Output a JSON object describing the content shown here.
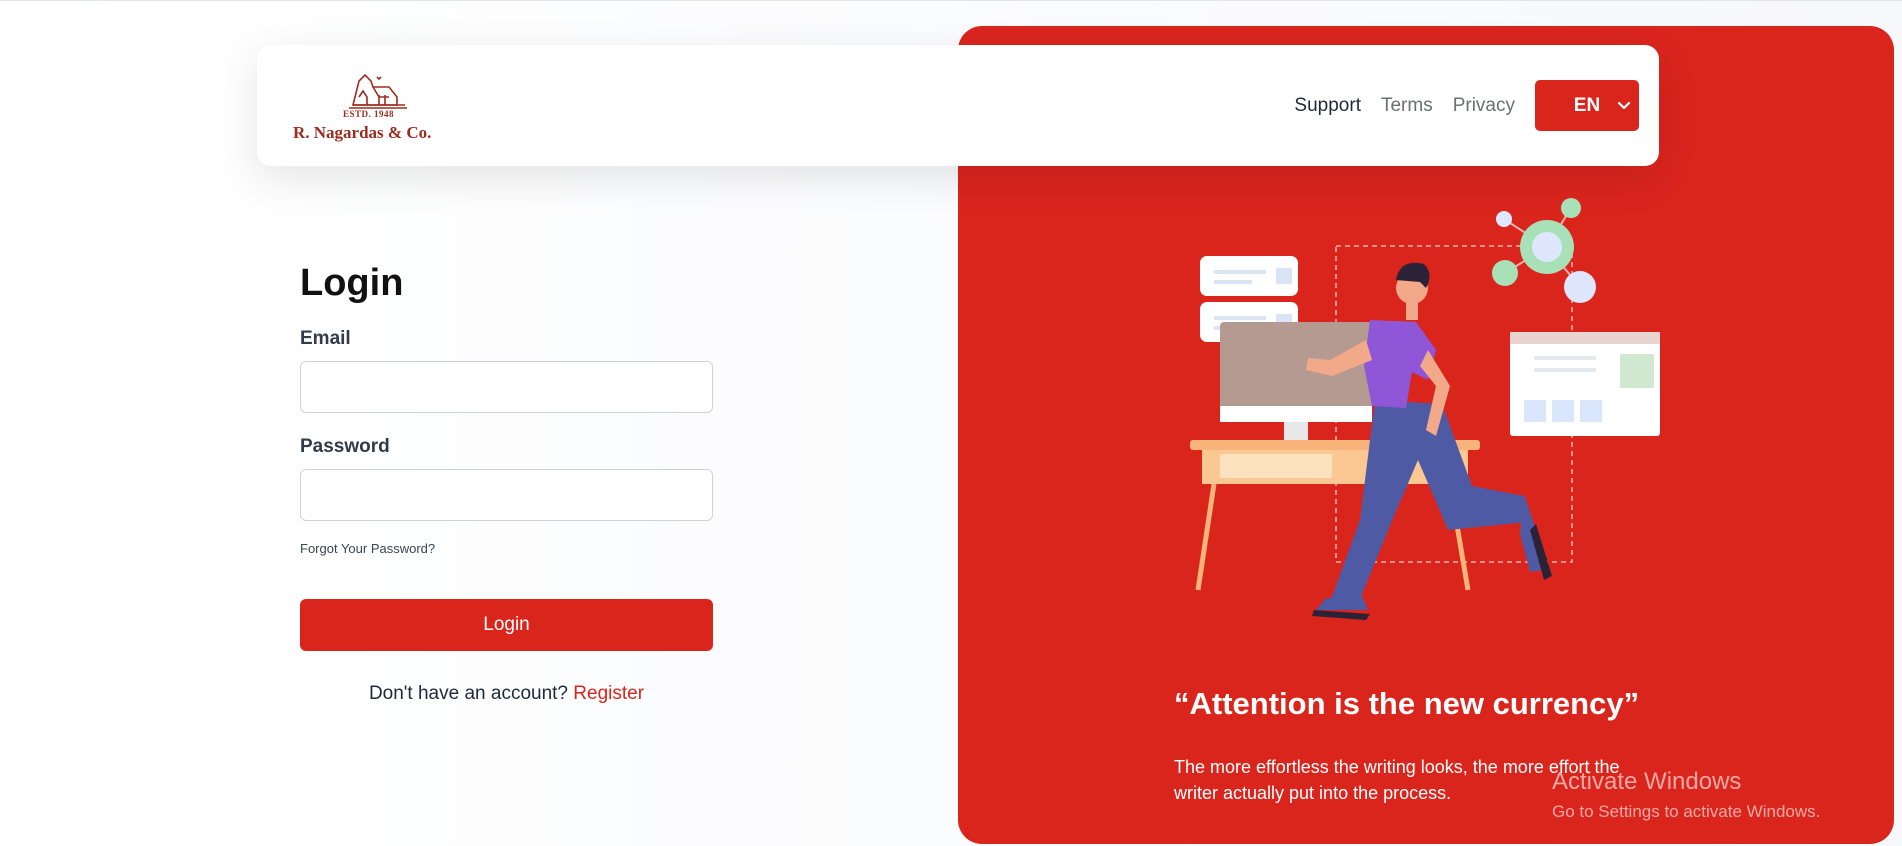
{
  "header": {
    "logo": {
      "estd": "ESTD. 1948",
      "name": "R. Nagardas & Co."
    },
    "nav": {
      "support": "Support",
      "terms": "Terms",
      "privacy": "Privacy"
    },
    "language": {
      "selected": "EN"
    }
  },
  "login": {
    "title": "Login",
    "email_label": "Email",
    "email_value": "",
    "password_label": "Password",
    "password_value": "",
    "forgot": "Forgot Your Password?",
    "submit": "Login",
    "no_account": "Don't have an account? ",
    "register": "Register"
  },
  "hero": {
    "quote": "“Attention is the new currency”",
    "body": "The more effortless the writing looks, the more effort the writer actually put into the process."
  },
  "os_overlay": {
    "title": "Activate Windows",
    "subtitle": "Go to Settings to activate Windows."
  },
  "colors": {
    "brand_red": "#da251d",
    "logo_brown": "#9b2d20"
  },
  "icons": [
    "building-logo-icon",
    "chevron-down-icon"
  ]
}
